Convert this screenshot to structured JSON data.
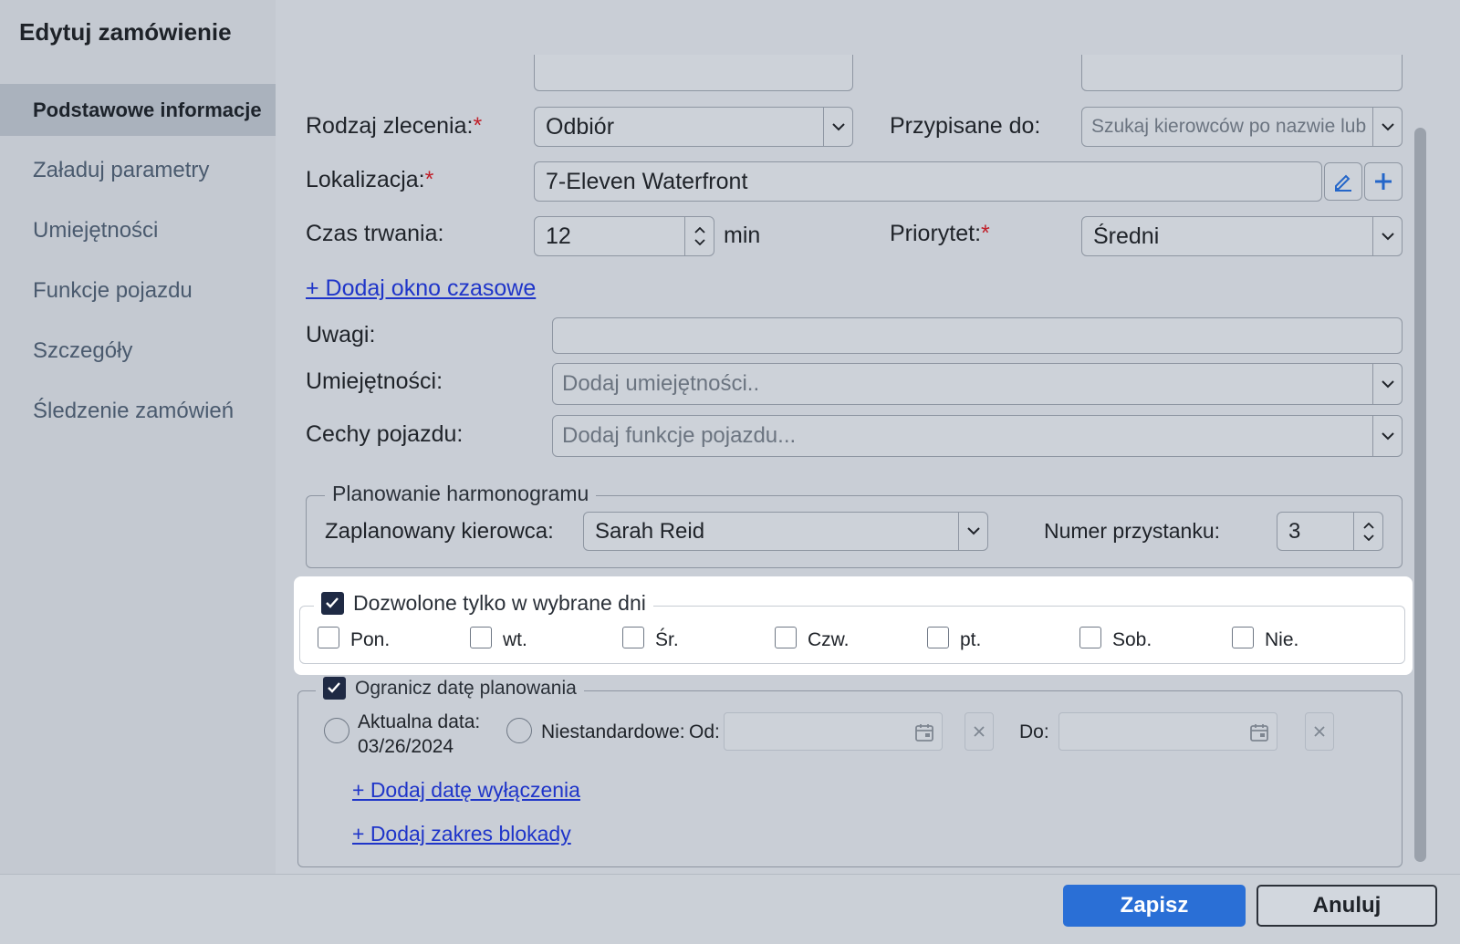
{
  "dialog": {
    "title": "Edytuj zamówienie"
  },
  "sidebar": {
    "items": [
      {
        "label": "Podstawowe informacje",
        "active": true
      },
      {
        "label": "Załaduj parametry"
      },
      {
        "label": "Umiejętności"
      },
      {
        "label": "Funkcje pojazdu"
      },
      {
        "label": "Szczegóły"
      },
      {
        "label": "Śledzenie zamówień"
      }
    ]
  },
  "form": {
    "order_type": {
      "label": "Rodzaj zlecenia:",
      "required_mark": "*",
      "value": "Odbiór"
    },
    "assigned_to": {
      "label": "Przypisane do:",
      "placeholder": "Szukaj kierowców po nazwie lub"
    },
    "location": {
      "label": "Lokalizacja:",
      "required_mark": "*",
      "value": "7-Eleven Waterfront"
    },
    "duration": {
      "label": "Czas trwania:",
      "value": "12",
      "unit": "min"
    },
    "priority": {
      "label": "Priorytet:",
      "required_mark": "*",
      "value": "Średni"
    },
    "add_time_window": "+ Dodaj okno czasowe",
    "notes": {
      "label": "Uwagi:",
      "value": ""
    },
    "skills": {
      "label": "Umiejętności:",
      "placeholder": "Dodaj umiejętności.."
    },
    "vehicle_features": {
      "label": "Cechy pojazdu:",
      "placeholder": "Dodaj funkcje pojazdu..."
    }
  },
  "schedule": {
    "legend": "Planowanie harmonogramu",
    "driver": {
      "label": "Zaplanowany kierowca:",
      "value": "Sarah Reid"
    },
    "stop_number": {
      "label": "Numer przystanku:",
      "value": "3"
    }
  },
  "days": {
    "legend": "Dozwolone tylko w wybrane dni",
    "checked": true,
    "items": [
      {
        "label": "Pon.",
        "checked": false
      },
      {
        "label": "wt.",
        "checked": false
      },
      {
        "label": "Śr.",
        "checked": false
      },
      {
        "label": "Czw.",
        "checked": false
      },
      {
        "label": "pt.",
        "checked": false
      },
      {
        "label": "Sob.",
        "checked": false
      },
      {
        "label": "Nie.",
        "checked": false
      }
    ]
  },
  "date_limit": {
    "legend": "Ogranicz datę planowania",
    "checked": true,
    "current_label": "Aktualna data:",
    "current_date": "03/26/2024",
    "custom_label": "Niestandardowe:",
    "from_label": "Od:",
    "to_label": "Do:",
    "add_exclusion": "+ Dodaj datę wyłączenia",
    "add_block_range": "+ Dodaj zakres blokady"
  },
  "footer": {
    "save_label": "Zapisz",
    "cancel_label": "Anuluj"
  },
  "colors": {
    "primary": "#2a6fd6",
    "link": "#1f35c9",
    "required": "#c0202a"
  }
}
